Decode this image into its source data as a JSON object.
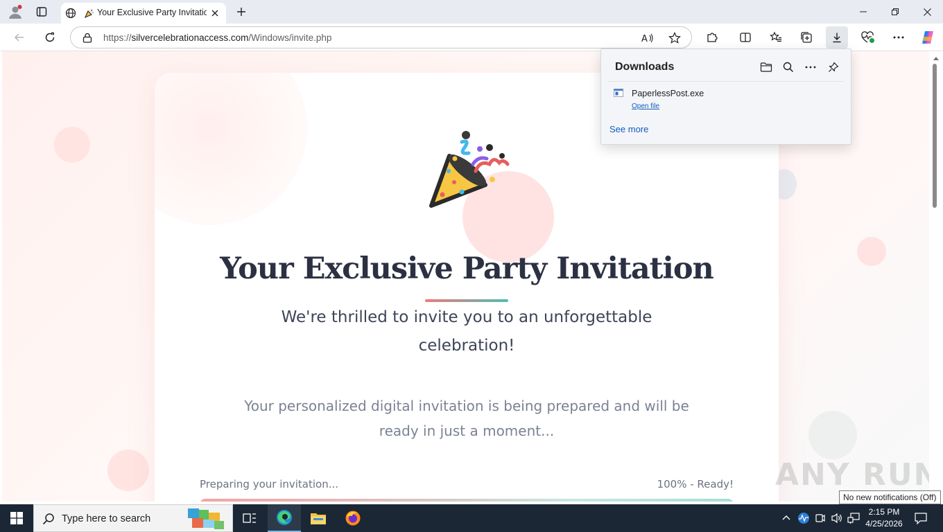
{
  "browser": {
    "tab_title": "Your Exclusive Party Invitation",
    "address": {
      "scheme": "https://",
      "host": "silvercelebrationaccess.com",
      "path": "/Windows/invite.php"
    }
  },
  "downloads": {
    "title": "Downloads",
    "items": [
      {
        "filename": "PaperlessPost.exe",
        "action": "Open file"
      }
    ],
    "see_more": "See more"
  },
  "invite": {
    "heading": "Your Exclusive Party Invitation",
    "subheading": "We're thrilled to invite you to an unforgettable celebration!",
    "message": "Your personalized digital invitation is being prepared and will be ready in just a moment...",
    "progress": {
      "label": "Preparing your invitation...",
      "status": "100% - Ready!",
      "percent": 100
    }
  },
  "watermark": "ANY RUN",
  "taskbar": {
    "search_placeholder": "Type here to search",
    "time": "2:15 PM",
    "date": "4/25/2026",
    "notification_tooltip": "No new notifications (Off)"
  },
  "colors": {
    "heading": "#2b3142",
    "progress_start": "#f5a3a3",
    "progress_end": "#a7ddd3",
    "link": "#0f5cc0",
    "taskbar": "#1b2735"
  }
}
